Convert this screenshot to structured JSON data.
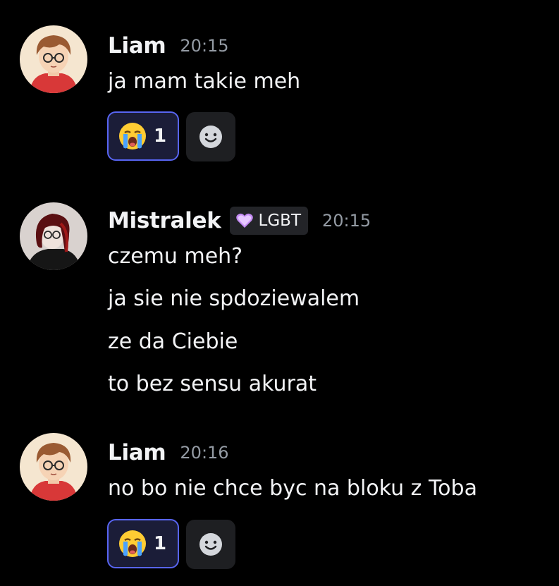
{
  "messages": [
    {
      "author": "Liam",
      "time": "20:15",
      "lines": [
        "ja mam takie meh"
      ],
      "reaction": {
        "emoji": "loudly-crying-face-icon",
        "count": "1"
      }
    },
    {
      "author": "Mistralek",
      "tag": {
        "icon": "purple-heart-icon",
        "label": "LGBT"
      },
      "time": "20:15",
      "lines": [
        "czemu meh?",
        "ja sie nie spdoziewalem",
        "ze da Ciebie",
        "to bez sensu akurat"
      ]
    },
    {
      "author": "Liam",
      "time": "20:16",
      "lines": [
        "no bo nie chce byc na bloku z Toba"
      ],
      "reaction": {
        "emoji": "loudly-crying-face-icon",
        "count": "1"
      }
    }
  ],
  "colors": {
    "background": "#000000",
    "text": "#f2f3f5",
    "muted": "#949ba4",
    "reaction_border": "#5865f2",
    "reaction_bg": "#1b1d38",
    "tag_bg": "#232428"
  }
}
